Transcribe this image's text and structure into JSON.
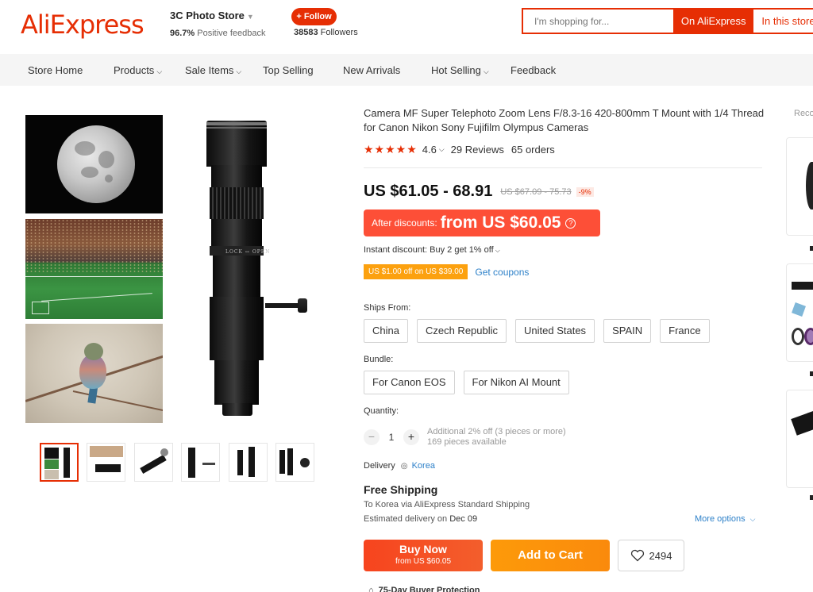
{
  "header": {
    "logo": "AliExpress",
    "store_name": "3C Photo Store",
    "feedback_pct": "96.7%",
    "feedback_label": "Positive feedback",
    "follow_label": "+ Follow",
    "followers_count": "38583",
    "followers_label": "Followers",
    "search_placeholder": "I'm shopping for...",
    "search_on_ali": "On AliExpress",
    "search_in_store": "In this store"
  },
  "nav": {
    "items": [
      {
        "label": "Store Home",
        "dropdown": false
      },
      {
        "label": "Products",
        "dropdown": true
      },
      {
        "label": "Sale Items",
        "dropdown": true
      },
      {
        "label": "Top Selling",
        "dropdown": false
      },
      {
        "label": "New Arrivals",
        "dropdown": false
      },
      {
        "label": "Hot Selling",
        "dropdown": true
      },
      {
        "label": "Feedback",
        "dropdown": false
      }
    ]
  },
  "product": {
    "title": "Camera MF Super Telephoto Zoom Lens F/8.3-16 420-800mm T Mount with 1/4 Thread for Canon Nikon Sony Fujifilm Olympus Cameras",
    "stars": "★★★★★",
    "rating": "4.6",
    "reviews": "29 Reviews",
    "orders": "65 orders",
    "price": "US $61.05 - 68.91",
    "old_price": "US $67.09 - 75.73",
    "discount_pct": "-9%",
    "after_discount_label": "After discounts:",
    "after_discount_price": "from US $60.05",
    "instant_discount": "Instant discount: Buy 2 get 1% off",
    "coupon_tag": "US $1.00 off on US $39.00",
    "get_coupons": "Get coupons",
    "ships_from_label": "Ships From:",
    "ships_from": [
      "China",
      "Czech Republic",
      "United States",
      "SPAIN",
      "France"
    ],
    "bundle_label": "Bundle:",
    "bundles": [
      "For Canon EOS",
      "For Nikon AI Mount"
    ],
    "quantity_label": "Quantity:",
    "quantity_value": "1",
    "quantity_note_1": "Additional 2% off (3 pieces or more)",
    "quantity_note_2": "169 pieces available",
    "delivery_label": "Delivery",
    "delivery_country": "Korea",
    "free_shipping": "Free Shipping",
    "ship_via": "To Korea via AliExpress Standard Shipping",
    "est_delivery_label": "Estimated delivery on",
    "est_delivery_date": "Dec 09",
    "more_options": "More options",
    "buy_now": "Buy Now",
    "buy_now_sub": "from US $60.05",
    "add_to_cart": "Add to Cart",
    "wishlist_count": "2494",
    "protection": "75-Day Buyer Protection"
  },
  "gallery": {
    "thumbnail_count": 6,
    "active_thumb": 0
  },
  "recommend": {
    "label": "Recommended"
  },
  "colors": {
    "brand": "#e62e04",
    "after_discount_bg": "#fd4f37",
    "coupon": "#fca10f",
    "link": "#2e81c9",
    "add_to_cart": "#fd9a0a"
  }
}
